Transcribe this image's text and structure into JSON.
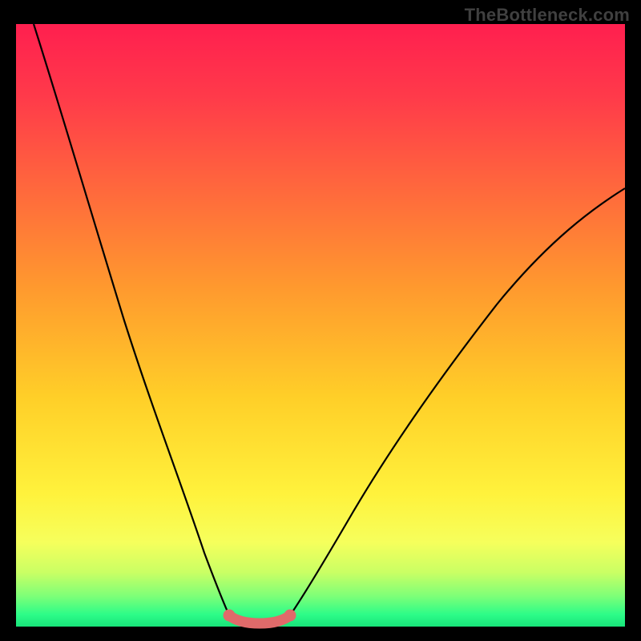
{
  "watermark": "TheBottleneck.com",
  "colors": {
    "frame_bg": "#000000",
    "gradient_top": "#ff1f4f",
    "gradient_mid1": "#ff9a2e",
    "gradient_mid2": "#fff23c",
    "gradient_bottom": "#18e47a",
    "curve_left": "#000000",
    "curve_right": "#000000",
    "flat_segment": "#e06a6a",
    "endpoint_dot": "#e06a6a"
  },
  "chart_data": {
    "type": "line",
    "title": "",
    "xlabel": "",
    "ylabel": "",
    "xlim": [
      0,
      100
    ],
    "ylim": [
      0,
      100
    ],
    "series": [
      {
        "name": "left-branch",
        "x": [
          3,
          6,
          10,
          14,
          18,
          22,
          26,
          29,
          31.5,
          33.5,
          35
        ],
        "values": [
          100,
          90,
          78,
          65,
          52,
          39,
          26,
          14,
          6,
          2,
          0.8
        ]
      },
      {
        "name": "right-branch",
        "x": [
          45,
          48,
          52,
          57,
          63,
          70,
          78,
          87,
          95,
          100
        ],
        "values": [
          0.8,
          2.5,
          6,
          12,
          20,
          30,
          42,
          55,
          66,
          73
        ]
      },
      {
        "name": "flat-bottom",
        "x": [
          35,
          37,
          39,
          41,
          43,
          45
        ],
        "values": [
          0.8,
          0.5,
          0.4,
          0.4,
          0.5,
          0.8
        ]
      }
    ],
    "annotations": []
  }
}
